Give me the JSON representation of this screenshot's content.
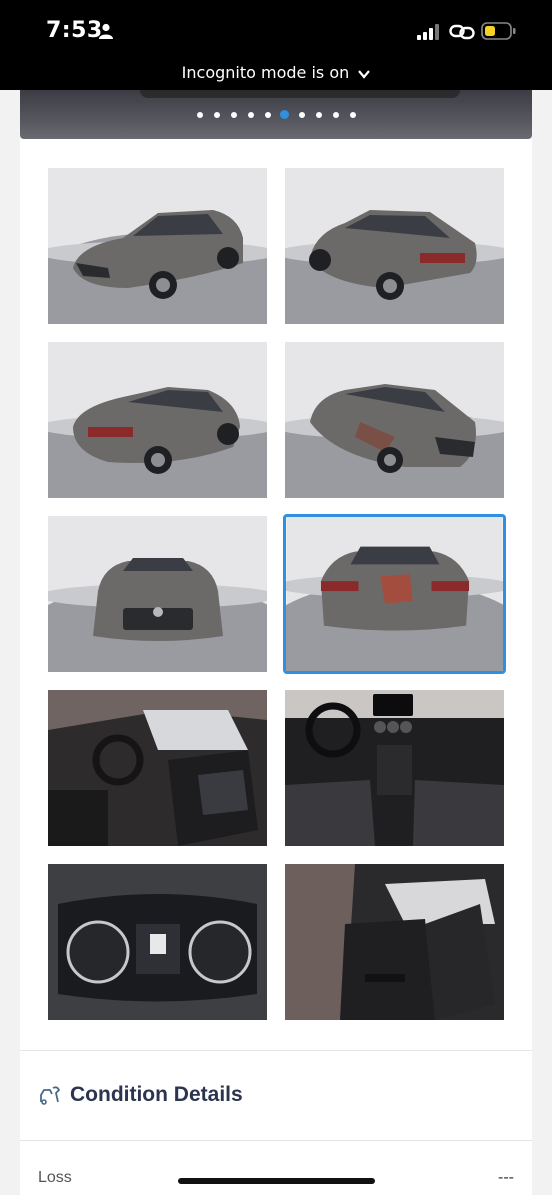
{
  "status_bar": {
    "time": "7:53",
    "icons": [
      "person-icon",
      "signal-icon",
      "link-icon",
      "battery-icon"
    ]
  },
  "incognito": {
    "label": "Incognito mode is on"
  },
  "carousel": {
    "dot_count": 10,
    "active_index": 5,
    "active_color": "#2f8fe0"
  },
  "gallery": {
    "selected_index": 5,
    "photos": [
      "front-left-exterior",
      "rear-right-exterior",
      "rear-left-exterior",
      "front-right-damage",
      "front-exterior",
      "rear-exterior",
      "driver-door-interior",
      "dashboard-interior",
      "instrument-cluster",
      "rear-seat-interior"
    ]
  },
  "condition": {
    "title": "Condition Details",
    "icon": "wrench-car-icon",
    "rows": [
      {
        "label": "Loss",
        "value": "---"
      }
    ]
  },
  "colors": {
    "accent": "#2f8fe0",
    "title": "#2b3550"
  }
}
